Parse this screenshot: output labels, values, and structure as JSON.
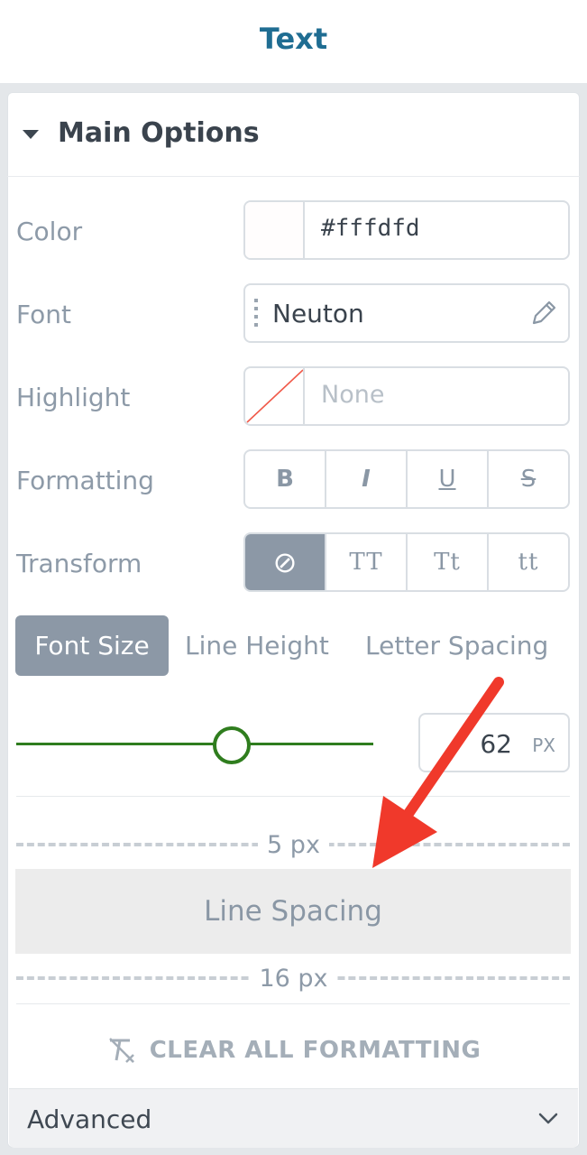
{
  "header": {
    "title": "Text"
  },
  "main_options": {
    "title": "Main Options",
    "color": {
      "label": "Color",
      "value": "#fffdfd",
      "swatch": "#fffdfd"
    },
    "font": {
      "label": "Font",
      "value": "Neuton"
    },
    "highlight": {
      "label": "Highlight",
      "placeholder": "None"
    },
    "formatting": {
      "label": "Formatting",
      "buttons": [
        "B",
        "I",
        "U",
        "S"
      ]
    },
    "transform": {
      "label": "Transform",
      "buttons": [
        "⊘",
        "TT",
        "Tt",
        "tt"
      ],
      "active_index": 0
    },
    "size_tabs": [
      "Font Size",
      "Line Height",
      "Letter Spacing"
    ],
    "size_tab_active": 0,
    "font_size": {
      "value": "62",
      "unit": "PX",
      "slider_fraction": 0.6
    },
    "spacing_preview": {
      "top_value": "5 px",
      "label": "Line Spacing",
      "bottom_value": "16 px"
    },
    "clear_formatting": "CLEAR ALL FORMATTING"
  },
  "advanced": {
    "label": "Advanced"
  },
  "colors": {
    "accent_title": "#1f6d92",
    "slider": "#2f7d1e",
    "active_tab": "#8c98a6",
    "annotation_arrow": "#f0392b"
  }
}
